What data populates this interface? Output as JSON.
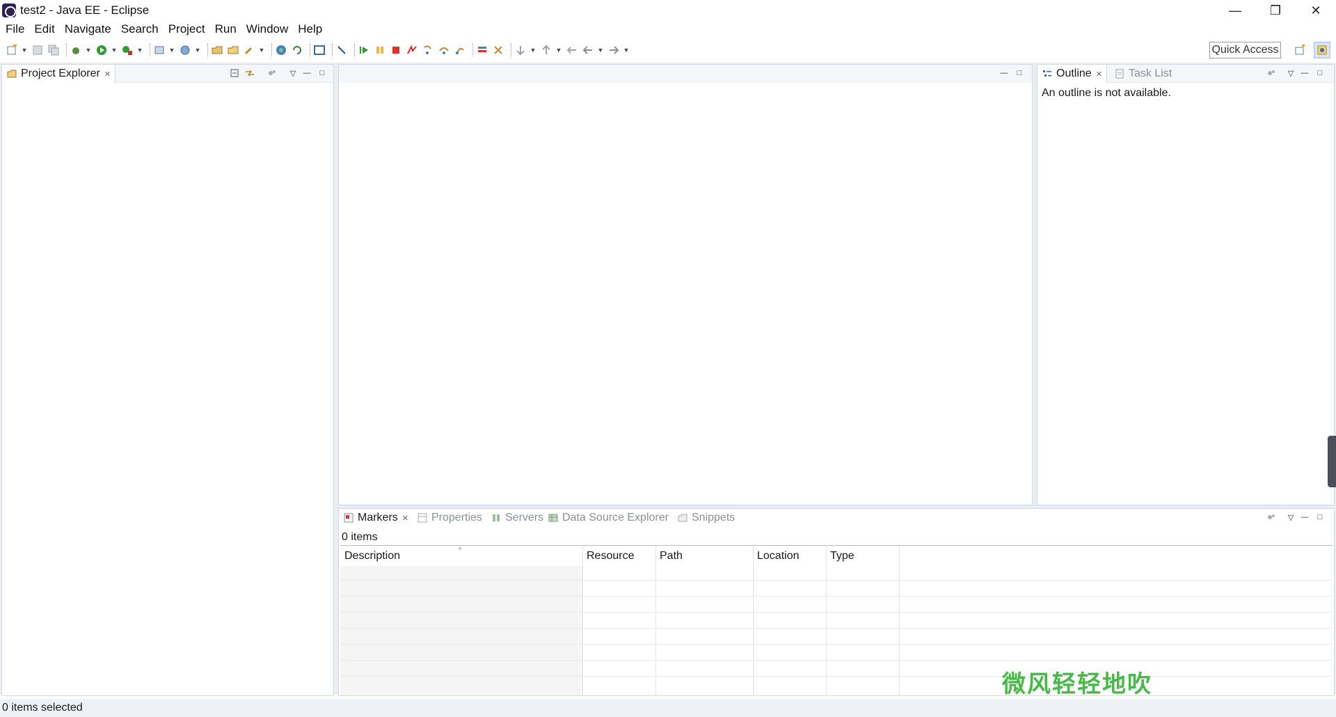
{
  "window": {
    "title": "test2 - Java EE - Eclipse",
    "controls": {
      "minimize": "—",
      "restore": "❐",
      "close": "✕"
    }
  },
  "menu": [
    "File",
    "Edit",
    "Navigate",
    "Search",
    "Project",
    "Run",
    "Window",
    "Help"
  ],
  "toolbar": {
    "quick_access": "Quick Access"
  },
  "left_panel": {
    "tab_label": "Project Explorer"
  },
  "right_panel": {
    "tabs": [
      {
        "label": "Outline",
        "active": true
      },
      {
        "label": "Task List",
        "active": false
      }
    ],
    "message": "An outline is not available."
  },
  "bottom_panel": {
    "tabs": [
      {
        "label": "Markers",
        "active": true
      },
      {
        "label": "Properties",
        "active": false
      },
      {
        "label": "Servers",
        "active": false
      },
      {
        "label": "Data Source Explorer",
        "active": false
      },
      {
        "label": "Snippets",
        "active": false
      }
    ],
    "items_count": "0 items",
    "columns": [
      "Description",
      "Resource",
      "Path",
      "Location",
      "Type"
    ]
  },
  "status": {
    "text": "0 items selected"
  },
  "watermark": "微风轻轻地吹",
  "colors": {
    "workspace_bg": "#e9eef5",
    "watermark": "#48b848"
  }
}
